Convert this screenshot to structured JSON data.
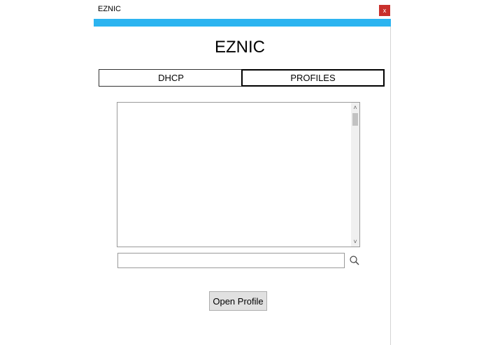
{
  "window": {
    "title": "EZNIC",
    "close_label": "x",
    "accent_color": "#2cb4f0",
    "close_color": "#c9302c"
  },
  "app": {
    "heading": "EZNIC"
  },
  "tabs": [
    {
      "label": "DHCP",
      "active": false
    },
    {
      "label": "PROFILES",
      "active": true
    }
  ],
  "profiles_list": {
    "items": [],
    "scroll_up_glyph": "˄",
    "scroll_down_glyph": "˅"
  },
  "search": {
    "value": "",
    "placeholder": "",
    "icon": "search-icon"
  },
  "actions": {
    "open_profile_label": "Open Profile"
  }
}
